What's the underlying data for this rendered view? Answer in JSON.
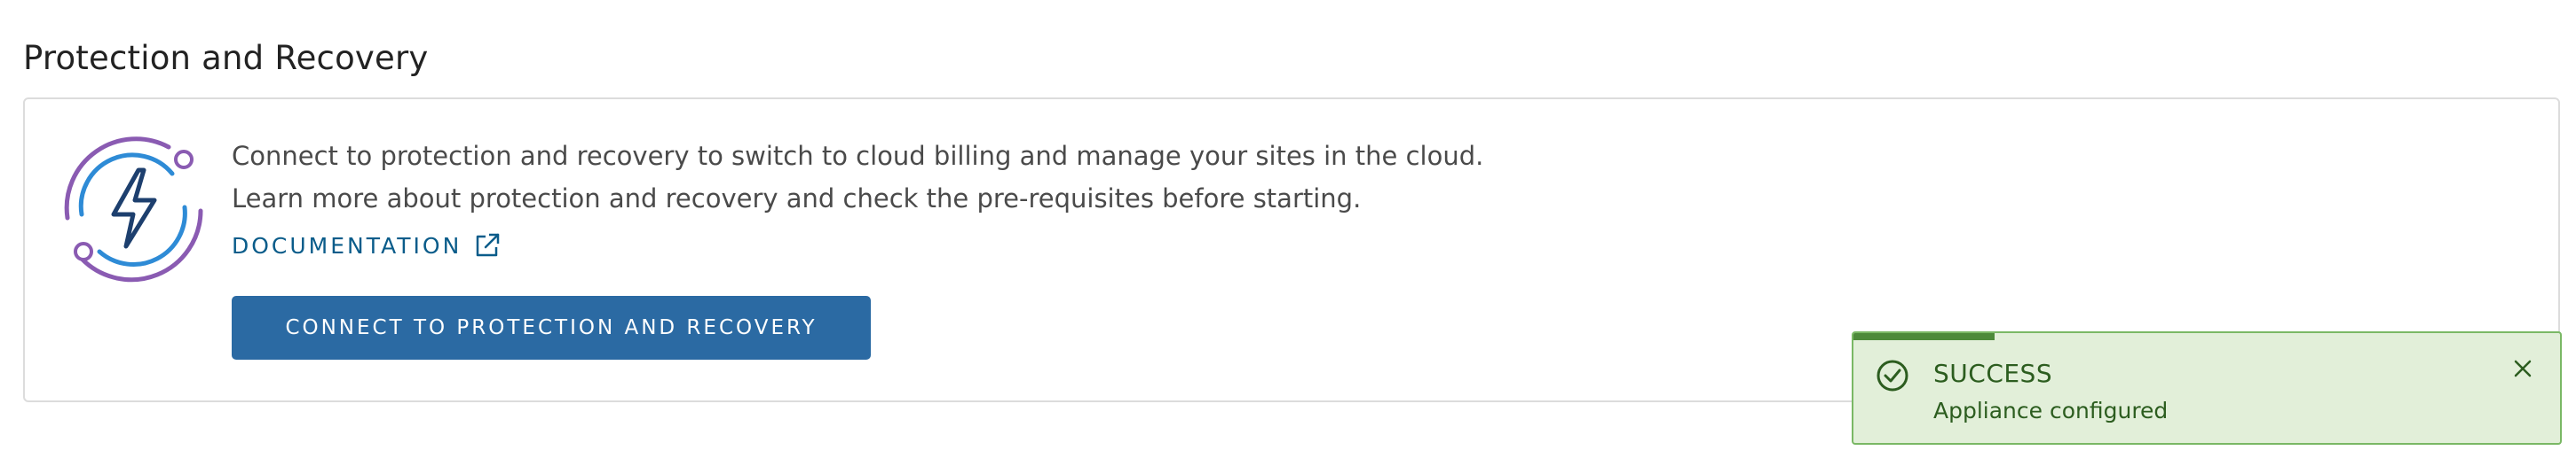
{
  "section": {
    "title": "Protection and Recovery"
  },
  "card": {
    "illustration_icon": "lightning-bolt-orbit-icon",
    "description_line1": "Connect to protection and recovery to switch to cloud billing and manage your sites in the cloud.",
    "description_line2": "Learn more about protection and recovery and check the pre-requisites before starting.",
    "documentation_label": "DOCUMENTATION",
    "documentation_icon": "external-link-icon",
    "connect_button_label": "CONNECT TO PROTECTION AND RECOVERY"
  },
  "toast": {
    "status_icon": "check-circle-icon",
    "title": "SUCCESS",
    "message": "Appliance configured",
    "close_icon": "close-icon",
    "progress_fraction": 0.2
  },
  "colors": {
    "primary_button": "#2b6aa3",
    "link": "#0a5c8a",
    "success_background": "#e2efd9",
    "success_border": "#7ab865",
    "success_progress": "#4d8a3a",
    "success_text": "#2c5d1f",
    "illustration_purple": "#8a5bb2",
    "illustration_blue": "#2e8bd6",
    "illustration_navy": "#1d3f6e"
  }
}
